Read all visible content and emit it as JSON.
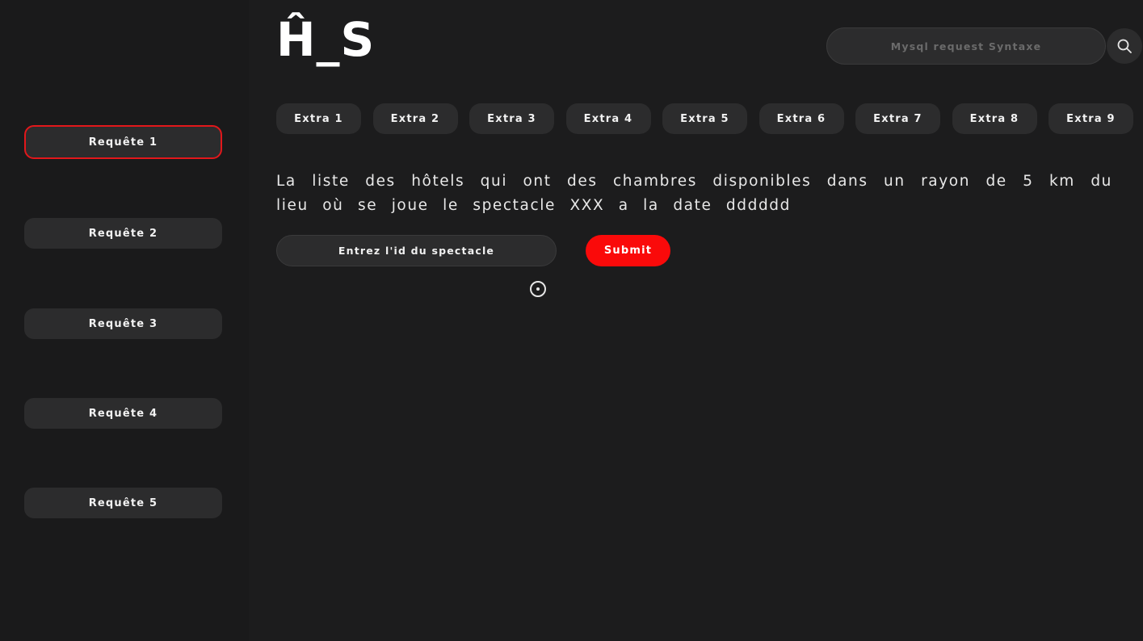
{
  "logo": {
    "text": "Ĥ_S"
  },
  "search": {
    "placeholder": "Mysql request Syntaxe",
    "icon": "search-icon"
  },
  "sidebar": {
    "items": [
      {
        "label": "Requête 1",
        "active": true
      },
      {
        "label": "Requête 2",
        "active": false
      },
      {
        "label": "Requête 3",
        "active": false
      },
      {
        "label": "Requête 4",
        "active": false
      },
      {
        "label": "Requête 5",
        "active": false
      }
    ]
  },
  "extras": {
    "items": [
      {
        "label": "Extra 1"
      },
      {
        "label": "Extra 2"
      },
      {
        "label": "Extra 3"
      },
      {
        "label": "Extra 4"
      },
      {
        "label": "Extra 5"
      },
      {
        "label": "Extra 6"
      },
      {
        "label": "Extra 7"
      },
      {
        "label": "Extra 8"
      },
      {
        "label": "Extra 9"
      }
    ]
  },
  "main": {
    "description": "La liste des hôtels qui ont des chambres disponibles dans un rayon de 5 km du lieu où se joue le spectacle XXX a la date dddddd",
    "id_input": {
      "placeholder": "Entrez l'id du spectacle",
      "value": ""
    },
    "submit_label": "Submit"
  },
  "colors": {
    "background": "#1c1c1d",
    "button": "#2c2c2d",
    "accent": "#fa0a0a",
    "active_border": "#e2171b"
  }
}
